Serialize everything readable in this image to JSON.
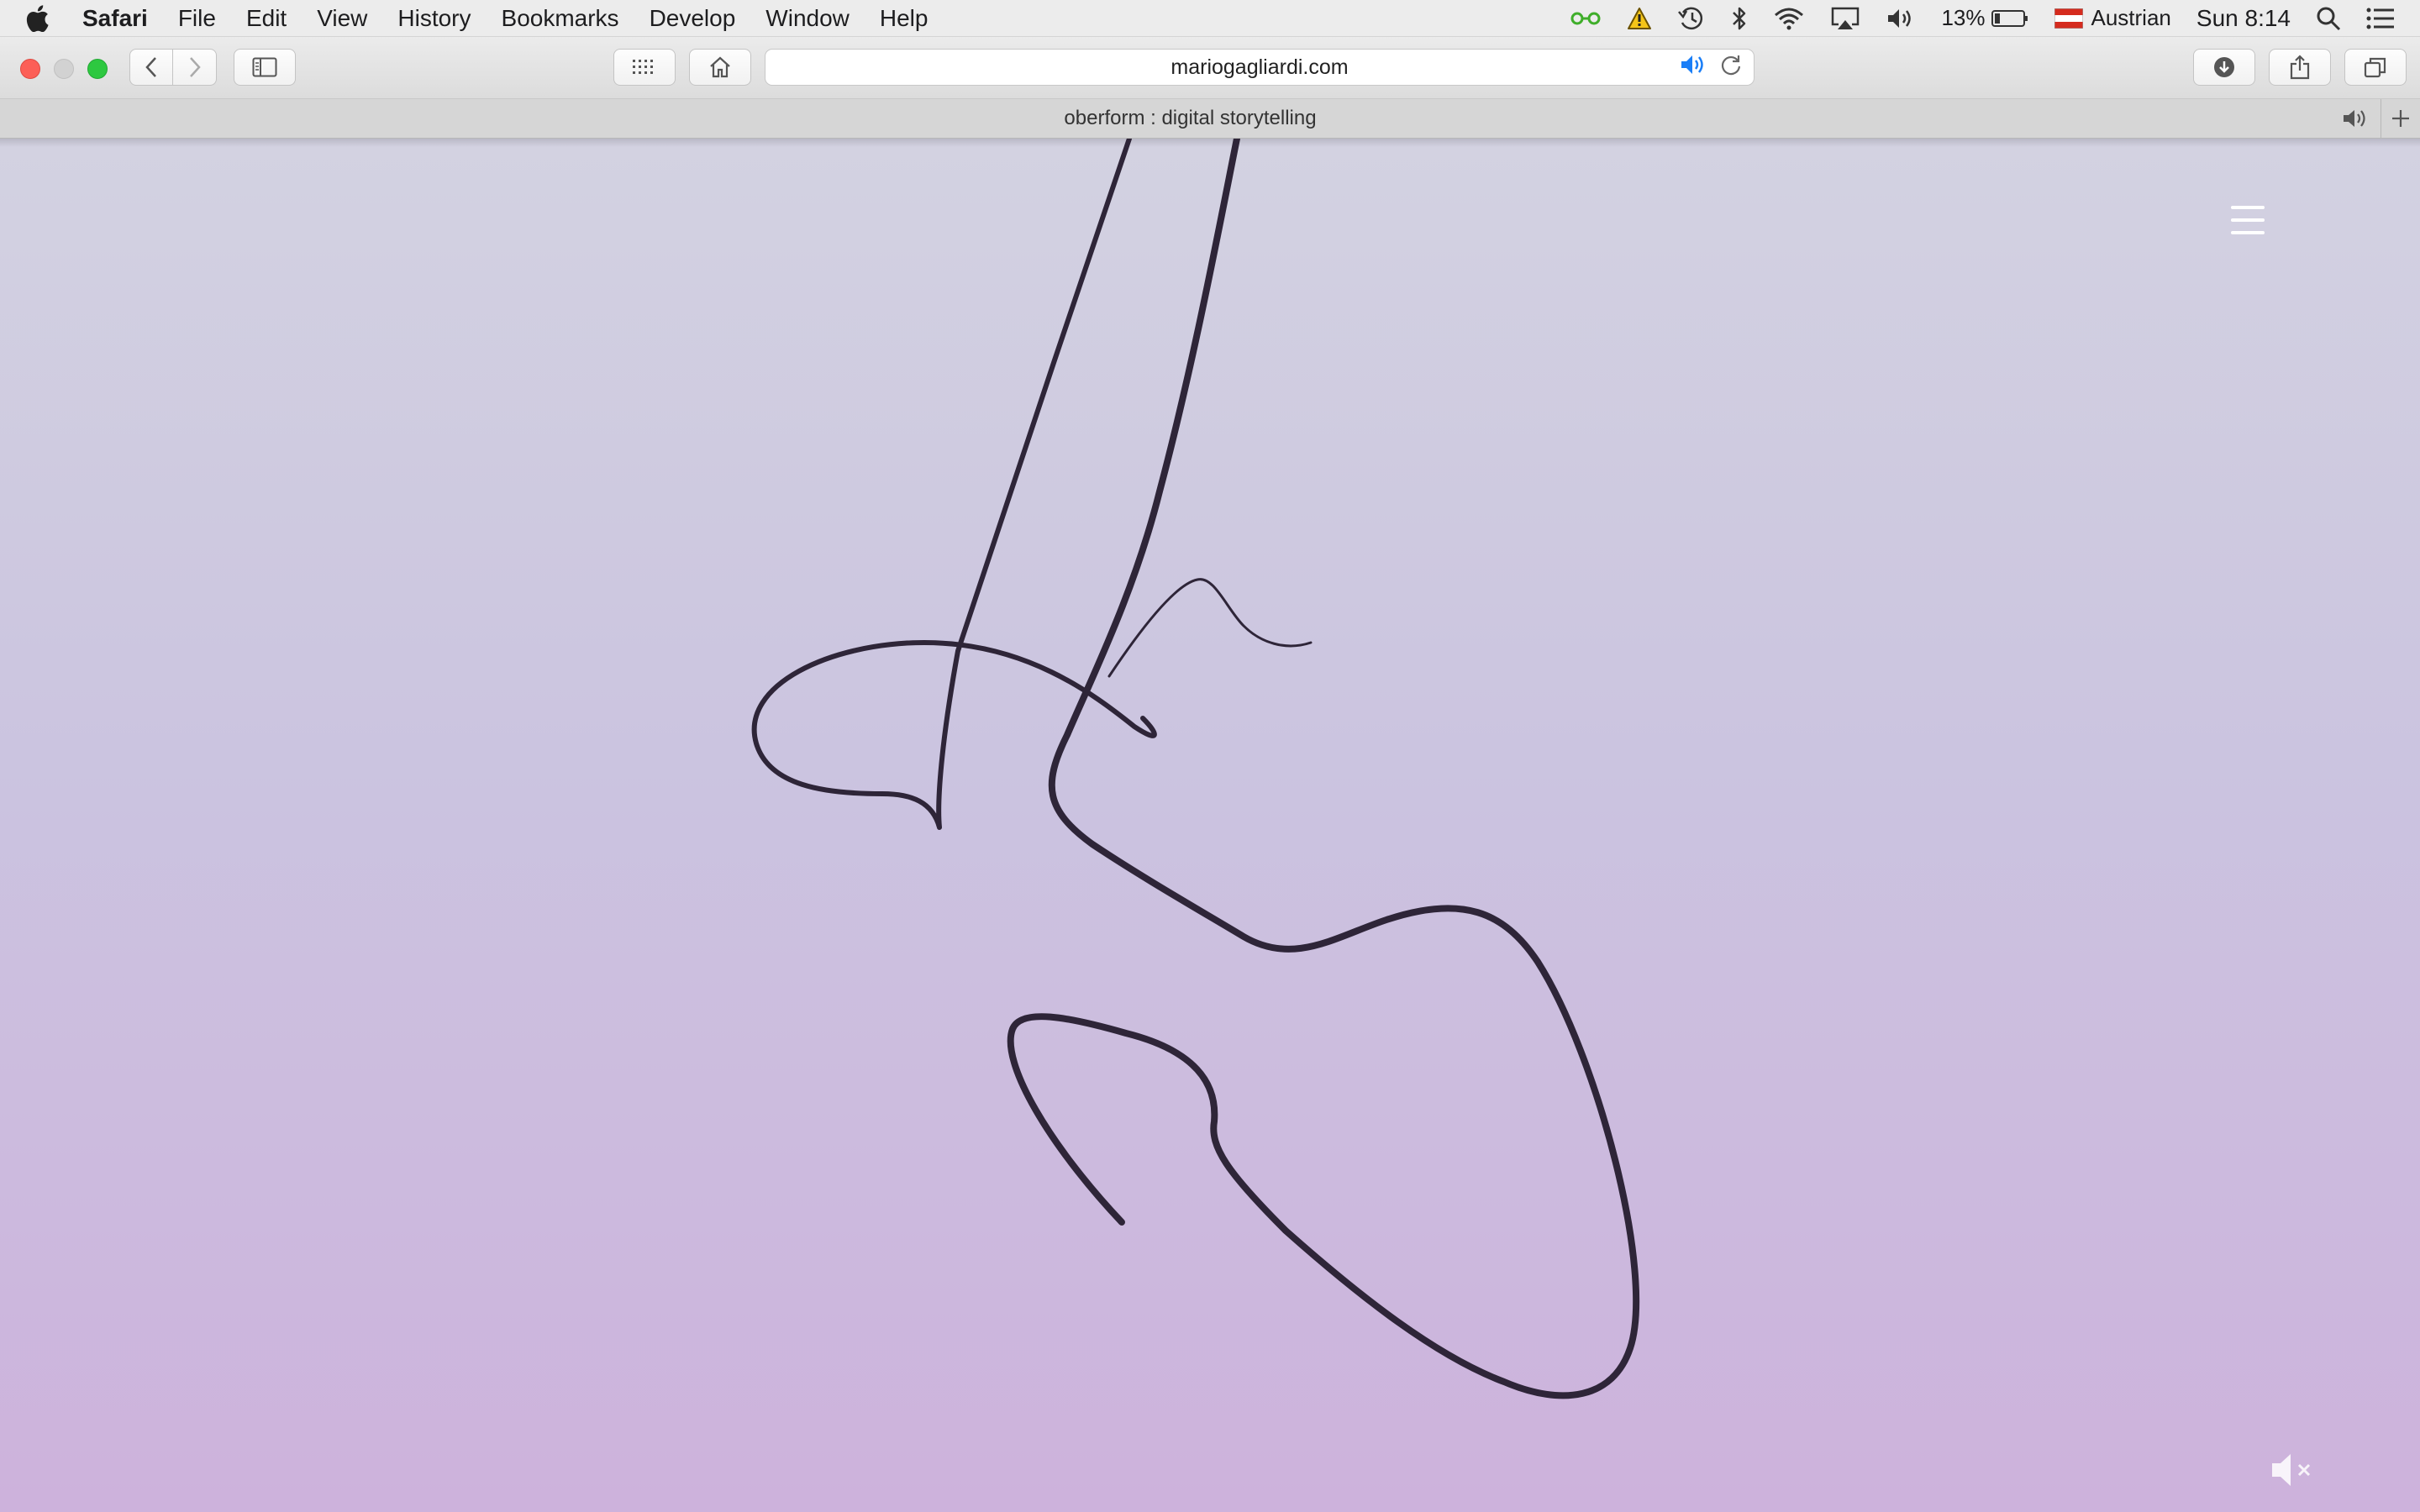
{
  "menubar": {
    "app_name": "Safari",
    "items": [
      "File",
      "Edit",
      "View",
      "History",
      "Bookmarks",
      "Develop",
      "Window",
      "Help"
    ],
    "battery_percent": "13%",
    "keyboard_layout": "Austrian",
    "clock": "Sun 8:14",
    "colors": {
      "vpn_green": "#3fae2a",
      "warning_yellow": "#f5c518"
    },
    "icons": [
      "vpn-icon",
      "warning-icon",
      "time-machine-icon",
      "bluetooth-icon",
      "wifi-icon",
      "airplay-icon",
      "volume-icon",
      "battery-icon",
      "flag-icon",
      "spotlight-icon",
      "notification-center-icon"
    ]
  },
  "toolbar": {
    "url": "mariogagliardi.com",
    "icons": [
      "back-icon",
      "forward-icon",
      "sidebar-icon",
      "top-sites-grid-icon",
      "home-icon",
      "audio-playing-icon",
      "reload-icon",
      "downloads-icon",
      "share-icon",
      "tabs-overview-icon"
    ]
  },
  "tab": {
    "title": "oberform : digital storytelling"
  },
  "page": {
    "background_top": "#d3d2e1",
    "background_bottom": "#cdb2dc",
    "stroke_color": "#2e2538",
    "icons": [
      "hamburger-menu-icon",
      "mute-icon"
    ]
  }
}
